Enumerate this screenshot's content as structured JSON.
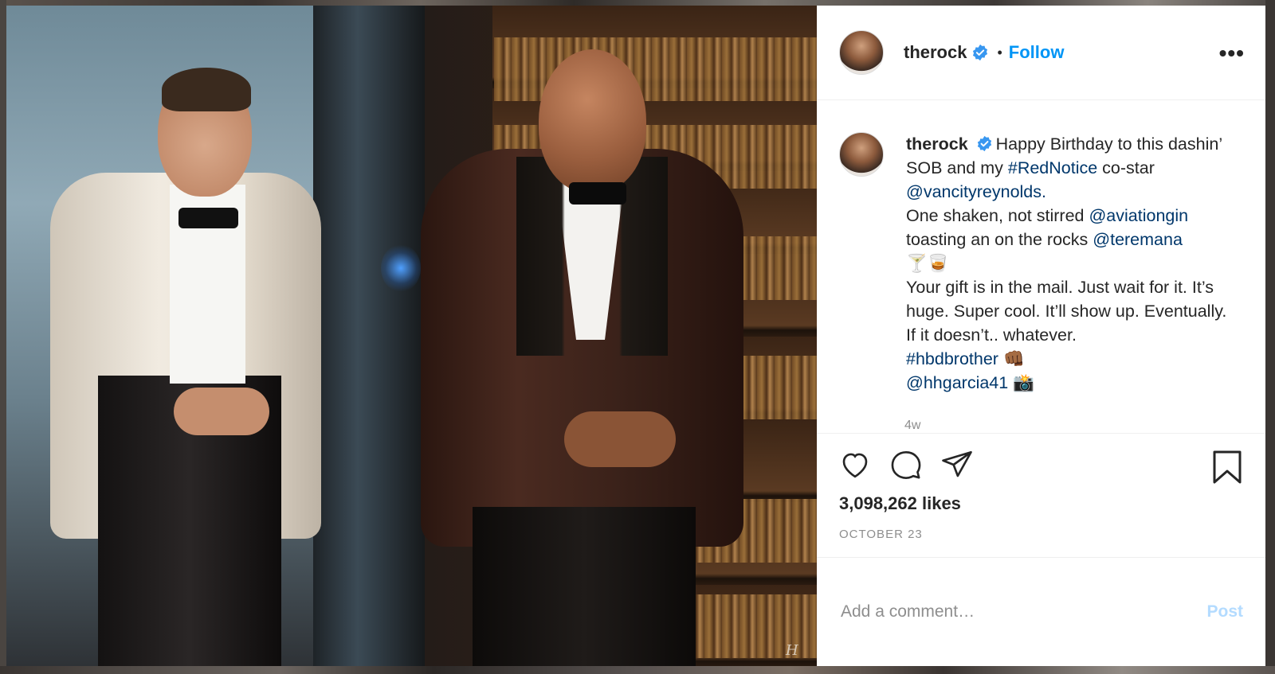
{
  "post": {
    "username": "therock",
    "follow_label": "Follow",
    "separator": "•",
    "more_label": "•••"
  },
  "caption": {
    "username": "therock",
    "line1_text": "Happy Birthday to this dashin’ SOB and my ",
    "hashtag1": "#RedNotice",
    "line1_after": " co-star ",
    "mention1": "@vancityreynolds",
    "period": ".",
    "line2_text": "One shaken, not stirred ",
    "mention2": "@aviationgin",
    "line3_text": "toasting an on the rocks ",
    "mention3": "@teremana",
    "emoji1": "🍸🥃",
    "line4": "Your gift is in the mail. Just wait for it. It’s huge. Super cool. It’ll show up. Eventually. If it doesn’t.. whatever.",
    "hashtag2": "#hbdbrother",
    "emoji2": "👊🏾",
    "mention4": "@hhgarcia41",
    "emoji3": "📸",
    "time": "4w"
  },
  "stats": {
    "likes": "3,098,262 likes",
    "date": "OCTOBER 23"
  },
  "comment_box": {
    "placeholder": "Add a comment…",
    "post_label": "Post"
  },
  "photo": {
    "watermark": "H"
  },
  "colors": {
    "link": "#00376b",
    "follow": "#0095f6",
    "post_disabled": "#b3dbff",
    "verified": "#3897f0"
  },
  "icons": [
    "heart-icon",
    "comment-icon",
    "share-icon",
    "bookmark-icon",
    "verified-badge-icon",
    "more-options-icon"
  ]
}
